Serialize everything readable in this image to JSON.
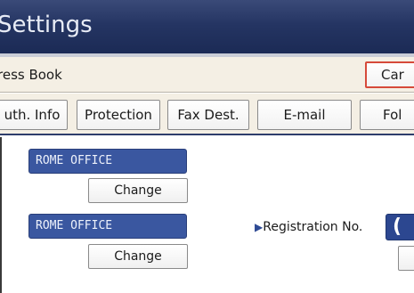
{
  "header": {
    "title": "Settings"
  },
  "breadcrumb": {
    "text": "ress Book",
    "cancel_label": "Car"
  },
  "tabs": [
    {
      "label": "uth. Info"
    },
    {
      "label": "Protection"
    },
    {
      "label": "Fax Dest."
    },
    {
      "label": "E-mail"
    },
    {
      "label": "Fol"
    }
  ],
  "form": {
    "name_field_1": "ROME OFFICE",
    "change_1": "Change",
    "name_field_2": "ROME OFFICE",
    "change_2": "Change",
    "registration_label": "Registration No.",
    "registration_arrow_icon": "triangle-right-icon",
    "registration_value": "("
  },
  "colors": {
    "title_bar": "#253563",
    "field_blue": "#3a57a0",
    "cancel_border": "#d64a3a",
    "page_bg": "#f4efe4"
  }
}
